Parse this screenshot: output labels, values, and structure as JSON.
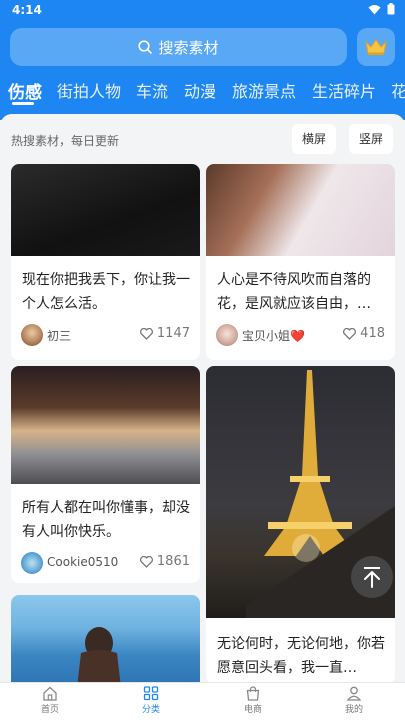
{
  "status": {
    "time": "4:14"
  },
  "search": {
    "placeholder": "搜索素材"
  },
  "tabs": [
    "伤感",
    "街拍人物",
    "车流",
    "动漫",
    "旅游景点",
    "生活碎片",
    "花"
  ],
  "hotbar": {
    "label": "热搜素材，每日更新",
    "landscape": "横屏",
    "portrait": "竖屏"
  },
  "cards": [
    {
      "title": "现在你把我丢下，你让我一个人怎么活。",
      "author": "初三",
      "likes": "1147"
    },
    {
      "title": "人心是不待风吹而自落的花，是风就应该自由，…",
      "author": "宝贝小姐❤️",
      "likes": "418"
    },
    {
      "title": "所有人都在叫你懂事，却没有人叫你快乐。",
      "author": "Cookie0510",
      "likes": "1861"
    },
    {
      "title": "无论何时，无论何地，你若愿意回头看，我一直…",
      "author": "",
      "likes": ""
    },
    {
      "title": "",
      "author": "",
      "likes": ""
    }
  ],
  "nav": [
    {
      "label": "首页",
      "icon": "home-icon"
    },
    {
      "label": "分类",
      "icon": "grid-icon"
    },
    {
      "label": "电商",
      "icon": "bag-icon"
    },
    {
      "label": "我的",
      "icon": "user-icon"
    }
  ],
  "colors": {
    "accent": "#1d86f2",
    "heart": "#e0203a"
  }
}
